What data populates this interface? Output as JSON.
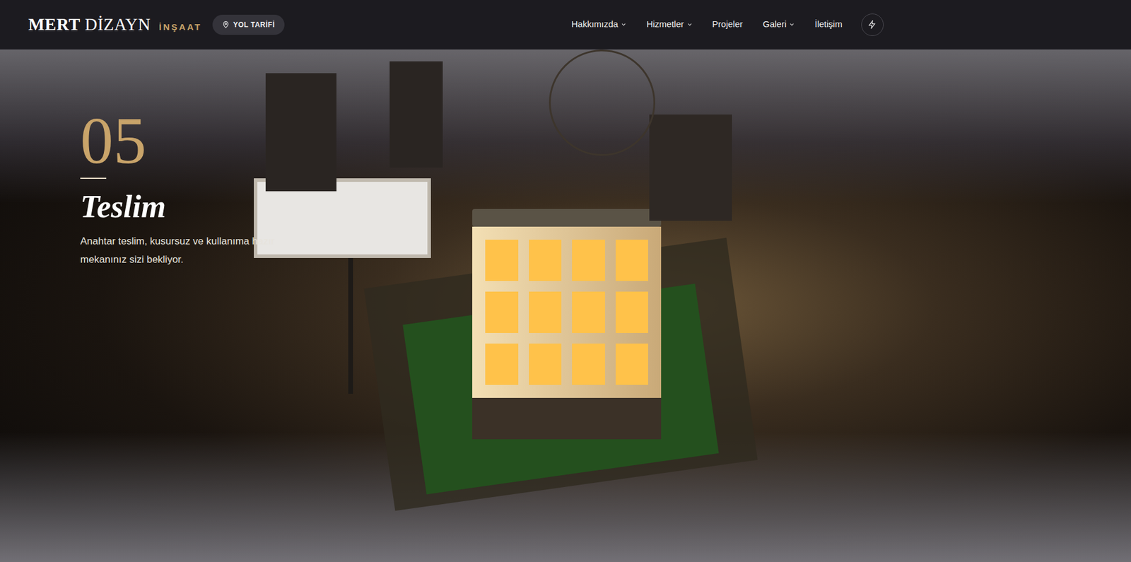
{
  "header": {
    "logo": {
      "primary": "MERT",
      "secondary": "DİZAYN",
      "tagline": "İNŞAAT"
    },
    "directions_button": "YOL TARİFİ",
    "nav": [
      {
        "label": "Hakkımızda",
        "dropdown": true
      },
      {
        "label": "Hizmetler",
        "dropdown": true
      },
      {
        "label": "Projeler",
        "dropdown": false
      },
      {
        "label": "Galeri",
        "dropdown": true
      },
      {
        "label": "İletişim",
        "dropdown": false
      }
    ]
  },
  "hero": {
    "step": "05",
    "title": "Teslim",
    "description": "Anahtar teslim, kusursuz ve kullanıma hazır mekanınız sizi bekliyor."
  }
}
